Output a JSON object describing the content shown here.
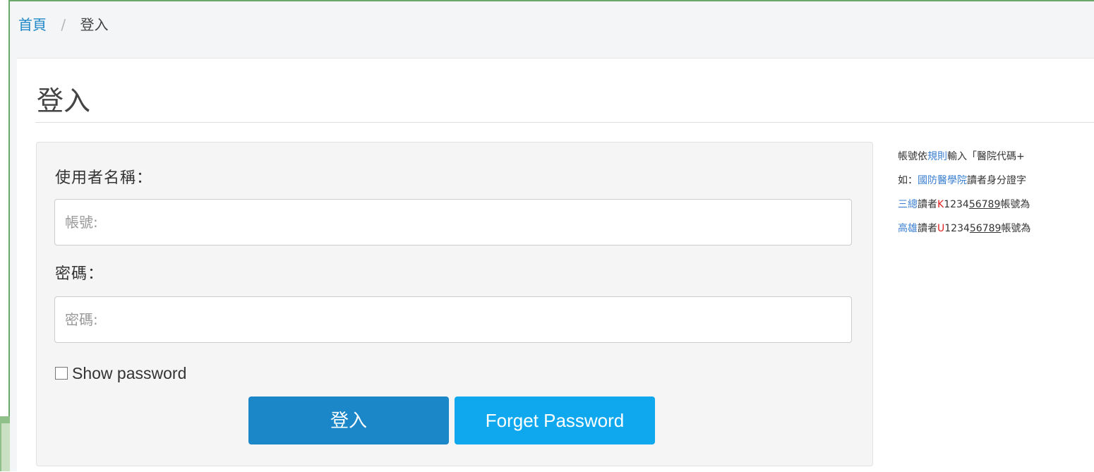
{
  "breadcrumb": {
    "home": "首頁",
    "separator": "/",
    "current": "登入"
  },
  "page": {
    "title": "登入"
  },
  "login_form": {
    "username_label": "使用者名稱：",
    "username_placeholder": "帳號:",
    "password_label": "密碼：",
    "password_placeholder": "密碼:",
    "show_password_label": "Show password",
    "show_password_checked": false,
    "login_button": "登入",
    "forget_button": "Forget Password"
  },
  "rules_text": {
    "line1": {
      "a": "帳號依",
      "b": "規則",
      "c": "輸入「醫院代碼+"
    },
    "line2": {
      "a": "如：",
      "b": "國防醫學院",
      "c": "讀者身分證字"
    },
    "line3": {
      "a": "三總",
      "b": "讀者",
      "c": "K",
      "d": "1234",
      "e": "56789",
      "f": "帳號為"
    },
    "line4": {
      "a": "高雄",
      "b": "讀者",
      "c": "U",
      "d": "1234",
      "e": "56789",
      "f": "帳號為"
    }
  },
  "colors": {
    "frame": "#6aa86a",
    "link": "#1f87c8",
    "login_button": "#1b87c9",
    "forget_button": "#0fa8ee",
    "highlight_red": "#e02020"
  }
}
